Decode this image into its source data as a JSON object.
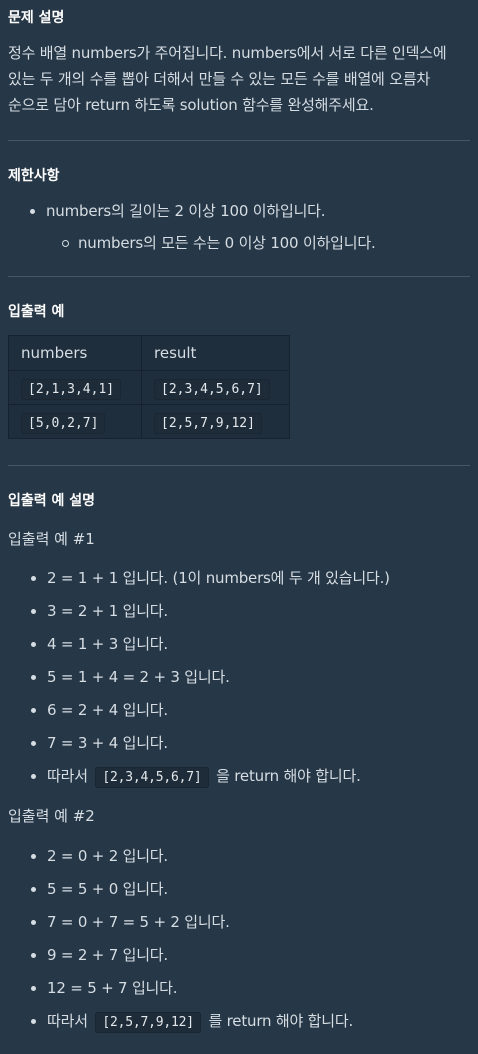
{
  "problem": {
    "heading": "문제 설명",
    "lines": [
      "정수 배열 numbers가 주어집니다. numbers에서 서로 다른 인덱스에",
      "있는 두 개의 수를 뽑아 더해서 만들 수 있는 모든 수를 배열에 오름차",
      "순으로 담아 return 하도록 solution 함수를 완성해주세요."
    ]
  },
  "constraints": {
    "heading": "제한사항",
    "items": [
      "numbers의 길이는 2 이상 100 이하입니다."
    ],
    "subitems": [
      "numbers의 모든 수는 0 이상 100 이하입니다."
    ]
  },
  "io_example": {
    "heading": "입출력 예",
    "columns": [
      "numbers",
      "result"
    ],
    "rows": [
      [
        "[2,1,3,4,1]",
        "[2,3,4,5,6,7]"
      ],
      [
        "[5,0,2,7]",
        "[2,5,7,9,12]"
      ]
    ]
  },
  "io_explanation": {
    "heading": "입출력 예 설명",
    "ex1": {
      "title": "입출력 예 #1",
      "items": [
        "2 = 1 + 1 입니다. (1이 numbers에 두 개 있습니다.)",
        "3 = 2 + 1 입니다.",
        "4 = 1 + 3 입니다.",
        "5 = 1 + 4 = 2 + 3 입니다.",
        "6 = 2 + 4 입니다.",
        "7 = 3 + 4 입니다."
      ],
      "final_prefix": "따라서",
      "final_code": "[2,3,4,5,6,7]",
      "final_suffix": "을 return 해야 합니다."
    },
    "ex2": {
      "title": "입출력 예 #2",
      "items": [
        "2 = 0 + 2 입니다.",
        "5 = 5 + 0 입니다.",
        "7 = 0 + 7 = 5 + 2 입니다.",
        "9 = 2 + 7 입니다.",
        "12 = 5 + 7 입니다."
      ],
      "final_prefix": "따라서",
      "final_code": "[2,5,7,9,12]",
      "final_suffix": "를 return 해야 합니다."
    }
  }
}
